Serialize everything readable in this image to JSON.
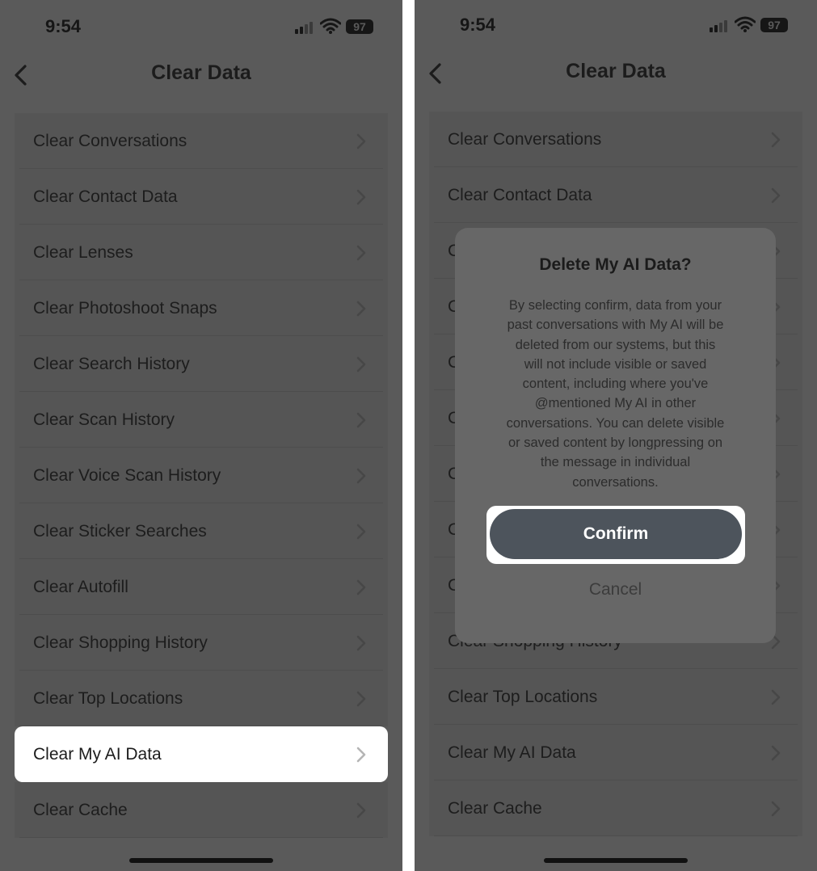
{
  "status": {
    "time": "9:54",
    "battery": "97"
  },
  "nav": {
    "title": "Clear Data"
  },
  "items": [
    {
      "label": "Clear Conversations"
    },
    {
      "label": "Clear Contact Data"
    },
    {
      "label": "Clear Lenses"
    },
    {
      "label": "Clear Photoshoot Snaps"
    },
    {
      "label": "Clear Search History"
    },
    {
      "label": "Clear Scan History"
    },
    {
      "label": "Clear Voice Scan History"
    },
    {
      "label": "Clear Sticker Searches"
    },
    {
      "label": "Clear Autofill"
    },
    {
      "label": "Clear Shopping History"
    },
    {
      "label": "Clear Top Locations"
    },
    {
      "label": "Clear My AI Data"
    },
    {
      "label": "Clear Cache"
    }
  ],
  "right_items": [
    {
      "label": "Clear Conversations"
    },
    {
      "label": "Clear Contact Data"
    },
    {
      "label": "C"
    },
    {
      "label": "C"
    },
    {
      "label": "C"
    },
    {
      "label": "C"
    },
    {
      "label": "C"
    },
    {
      "label": "C"
    },
    {
      "label": "C"
    },
    {
      "label": "Clear Shopping History"
    },
    {
      "label": "Clear Top Locations"
    },
    {
      "label": "Clear My AI Data"
    },
    {
      "label": "Clear Cache"
    }
  ],
  "highlighted_item": "Clear My AI Data",
  "dialog": {
    "title": "Delete My AI Data?",
    "lines": [
      "By selecting confirm, data from your",
      "past conversations with My AI will be",
      "deleted from our systems, but this",
      "will not include visible or saved",
      "content, including where you've",
      "@mentioned My AI in other",
      "conversations. You can delete visible",
      "or saved content by longpressing on",
      "the message in individual",
      "conversations."
    ],
    "confirm_label": "Confirm",
    "cancel_label": "Cancel"
  },
  "colors": {
    "dim_background": "#5a5a5a",
    "confirm_button": "#4d545c",
    "highlight": "#ffffff"
  }
}
